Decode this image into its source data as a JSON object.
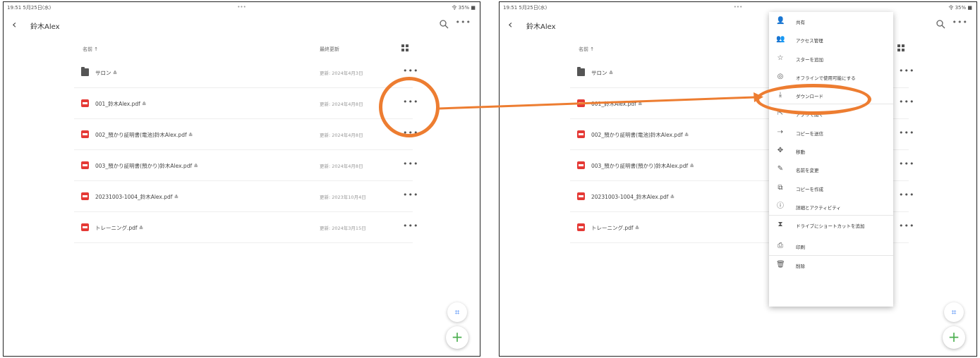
{
  "status": {
    "time": "19:51 5月25日(水)",
    "center": "•••",
    "battery": "令 35% ■"
  },
  "folder_title": "鈴木Alex",
  "header": {
    "name": "名前 ↑",
    "modified": "最終更新",
    "grid_icon": "grid-view-icon"
  },
  "files": [
    {
      "name": "サロン ≗",
      "date": "更新: 2024年4月3日",
      "type": "folder"
    },
    {
      "name": "001_鈴木Alex.pdf ≗",
      "date": "更新: 2024年4月8日",
      "type": "pdf"
    },
    {
      "name": "002_預かり証明書(電池)鈴木Alex.pdf ≗",
      "date": "更新: 2024年4月8日",
      "type": "pdf"
    },
    {
      "name": "003_預かり証明書(預かり)鈴木Alex.pdf ≗",
      "date": "更新: 2024年4月8日",
      "type": "pdf"
    },
    {
      "name": "20231003-1004_鈴木Alex.pdf ≗",
      "date": "更新: 2023年10月4日",
      "type": "pdf"
    },
    {
      "name": "トレーニング.pdf ≗",
      "date": "更新: 2024年3月15日",
      "type": "pdf"
    }
  ],
  "row_more": "•••",
  "fab_add": "+",
  "fab_scan": "⌗",
  "menu": [
    {
      "icon": "person-add-icon",
      "glyph": "👤",
      "label": "共有"
    },
    {
      "icon": "manage-access-icon",
      "glyph": "👥",
      "label": "アクセス管理"
    },
    {
      "icon": "star-icon",
      "glyph": "☆",
      "label": "スターを追加"
    },
    {
      "icon": "offline-icon",
      "glyph": "◎",
      "label": "オフラインで使用可能にする"
    },
    {
      "icon": "download-icon",
      "glyph": "⤓",
      "label": "ダウンロード"
    },
    {
      "icon": "open-in-icon",
      "glyph": "⇱",
      "label": "アプリで開く"
    },
    {
      "icon": "send-copy-icon",
      "glyph": "⇢",
      "label": "コピーを送信"
    },
    {
      "icon": "move-icon",
      "glyph": "✥",
      "label": "移動"
    },
    {
      "icon": "rename-icon",
      "glyph": "✎",
      "label": "名前を変更"
    },
    {
      "icon": "copy-icon",
      "glyph": "⧉",
      "label": "コピーを作成"
    },
    {
      "icon": "info-icon",
      "glyph": "ⓘ",
      "label": "詳細とアクティビティ"
    },
    {
      "icon": "shortcut-icon",
      "glyph": "⧗",
      "label": "ドライブにショートカットを追加"
    },
    {
      "icon": "print-icon",
      "glyph": "⎙",
      "label": "印刷"
    },
    {
      "icon": "delete-icon",
      "glyph": "🗑",
      "label": "削除"
    }
  ],
  "colors": {
    "highlight": "#ed7d31",
    "pdf": "#e53935"
  }
}
